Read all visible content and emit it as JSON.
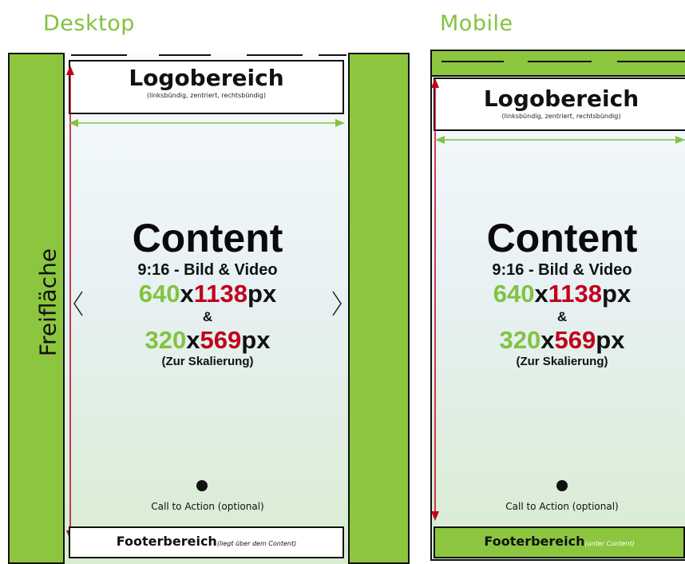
{
  "desktop": {
    "heading": "Desktop",
    "side_label": "Freifläche",
    "logo_title": "Logobereich",
    "logo_subtitle": "(linksbündig, zentriert, rechtsbündig)",
    "content_title": "Content",
    "aspect_line": "9:16 - Bild & Video",
    "size_large_w": "640",
    "size_large_x": "x",
    "size_large_h": "1138",
    "size_large_unit": "px",
    "ampersand": "&",
    "size_small_w": "320",
    "size_small_x": "x",
    "size_small_h": "569",
    "size_small_unit": "px",
    "scaling_note": "(Zur Skalierung)",
    "cta_label": "Call to Action (optional)",
    "footer_title": "Footerbereich",
    "footer_note": "(liegt über dem Content)",
    "nav_prev_icon": "chevron-left-icon",
    "nav_next_icon": "chevron-right-icon"
  },
  "mobile": {
    "heading": "Mobile",
    "logo_title": "Logobereich",
    "logo_subtitle": "(linksbündig, zentriert, rechtsbündig)",
    "content_title": "Content",
    "aspect_line": "9:16 - Bild & Video",
    "size_large_w": "640",
    "size_large_x": "x",
    "size_large_h": "1138",
    "size_large_unit": "px",
    "ampersand": "&",
    "size_small_w": "320",
    "size_small_x": "x",
    "size_small_h": "569",
    "size_small_unit": "px",
    "scaling_note": "(Zur Skalierung)",
    "cta_label": "Call to Action (optional)",
    "footer_title": "Footerbereich",
    "footer_note": "(unter Content)"
  },
  "colors": {
    "green": "#82c341",
    "side_green": "#8cc63f",
    "red": "#c0001c",
    "arrow_red": "#c0001c",
    "arrow_green": "#82c341"
  }
}
